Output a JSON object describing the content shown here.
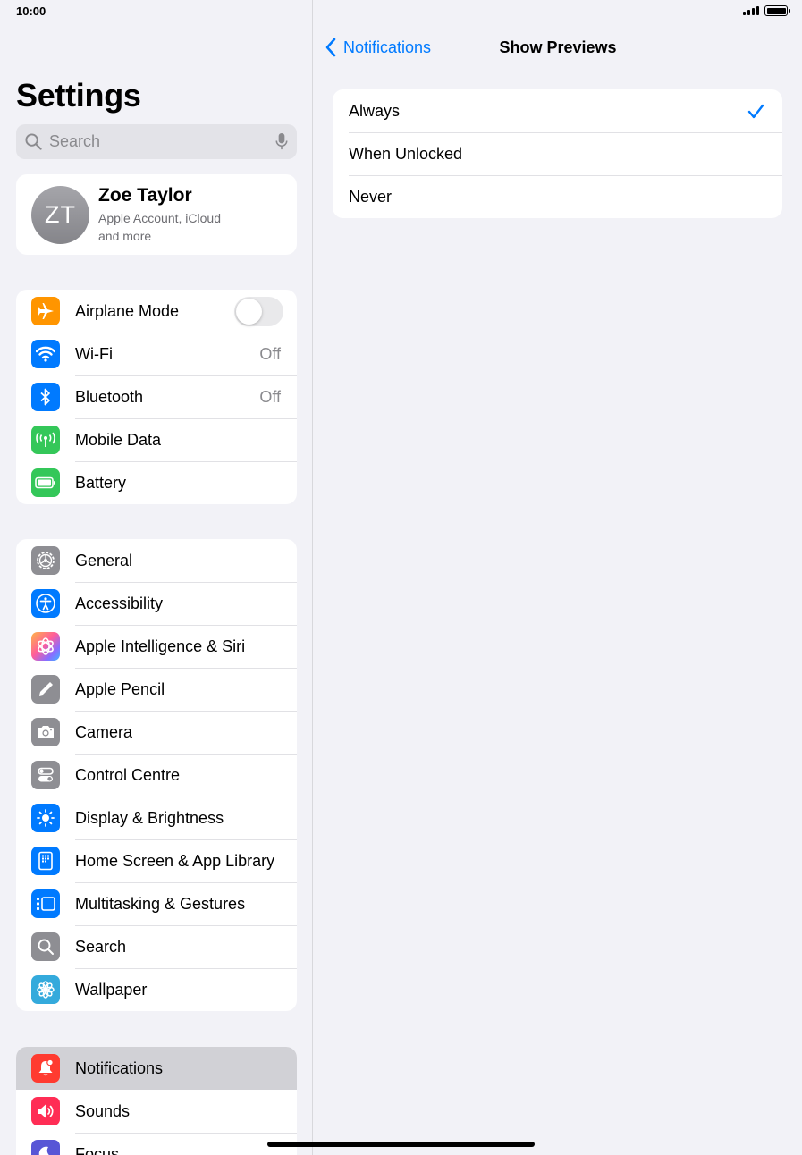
{
  "status_bar": {
    "time": "10:00"
  },
  "sidebar": {
    "title": "Settings",
    "search_placeholder": "Search",
    "profile": {
      "initials": "ZT",
      "name": "Zoe Taylor",
      "subtitle": "Apple Account, iCloud and more"
    },
    "group1": [
      {
        "label": "Airplane Mode",
        "icon": "airplane-icon",
        "color": "#ff9500",
        "toggle": false
      },
      {
        "label": "Wi-Fi",
        "icon": "wifi-icon",
        "color": "#007aff",
        "value": "Off"
      },
      {
        "label": "Bluetooth",
        "icon": "bluetooth-icon",
        "color": "#007aff",
        "value": "Off"
      },
      {
        "label": "Mobile Data",
        "icon": "antenna-icon",
        "color": "#34c759"
      },
      {
        "label": "Battery",
        "icon": "battery-icon",
        "color": "#34c759"
      }
    ],
    "group2": [
      {
        "label": "General",
        "icon": "gear-icon",
        "color": "#8e8e93"
      },
      {
        "label": "Accessibility",
        "icon": "accessibility-icon",
        "color": "#007aff"
      },
      {
        "label": "Apple Intelligence & Siri",
        "icon": "siri-icon",
        "color": "#ff6b9a"
      },
      {
        "label": "Apple Pencil",
        "icon": "pencil-icon",
        "color": "#8e8e93"
      },
      {
        "label": "Camera",
        "icon": "camera-icon",
        "color": "#8e8e93"
      },
      {
        "label": "Control Centre",
        "icon": "toggles-icon",
        "color": "#8e8e93"
      },
      {
        "label": "Display & Brightness",
        "icon": "sun-icon",
        "color": "#007aff"
      },
      {
        "label": "Home Screen & App Library",
        "icon": "home-screen-icon",
        "color": "#007aff"
      },
      {
        "label": "Multitasking & Gestures",
        "icon": "multitasking-icon",
        "color": "#007aff"
      },
      {
        "label": "Search",
        "icon": "search-icon",
        "color": "#8e8e93"
      },
      {
        "label": "Wallpaper",
        "icon": "flower-icon",
        "color": "#34aadc"
      }
    ],
    "group3": [
      {
        "label": "Notifications",
        "icon": "bell-icon",
        "color": "#ff3b30",
        "selected": true
      },
      {
        "label": "Sounds",
        "icon": "speaker-icon",
        "color": "#ff2d55"
      },
      {
        "label": "Focus",
        "icon": "moon-icon",
        "color": "#5856d6"
      }
    ]
  },
  "detail": {
    "back_label": "Notifications",
    "title": "Show Previews",
    "options": [
      {
        "label": "Always",
        "checked": true
      },
      {
        "label": "When Unlocked",
        "checked": false
      },
      {
        "label": "Never",
        "checked": false
      }
    ]
  }
}
